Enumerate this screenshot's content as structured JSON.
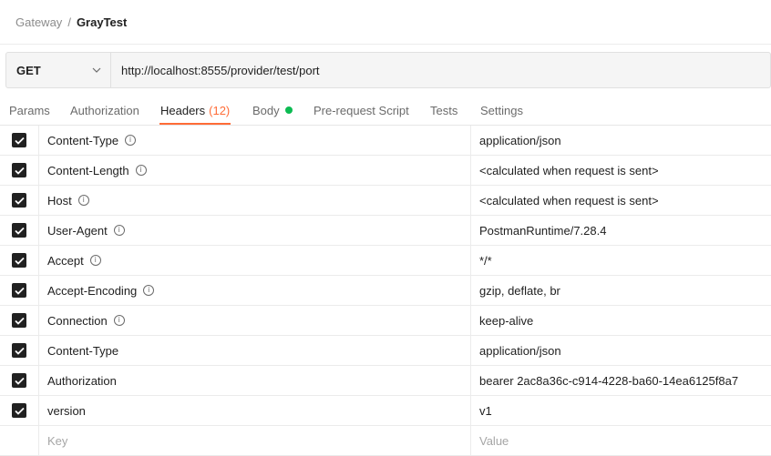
{
  "breadcrumb": {
    "parent": "Gateway",
    "separator": "/",
    "current": "GrayTest"
  },
  "request": {
    "method": "GET",
    "url": "http://localhost:8555/provider/test/port"
  },
  "tabs": [
    {
      "label": "Params",
      "count": "",
      "dot": false,
      "active": false
    },
    {
      "label": "Authorization",
      "count": "",
      "dot": false,
      "active": false
    },
    {
      "label": "Headers",
      "count": "(12)",
      "dot": false,
      "active": true
    },
    {
      "label": "Body",
      "count": "",
      "dot": true,
      "active": false
    },
    {
      "label": "Pre-request Script",
      "count": "",
      "dot": false,
      "active": false
    },
    {
      "label": "Tests",
      "count": "",
      "dot": false,
      "active": false
    },
    {
      "label": "Settings",
      "count": "",
      "dot": false,
      "active": false
    }
  ],
  "headers": [
    {
      "key": "Content-Type",
      "value": "application/json",
      "checked": true,
      "info": true
    },
    {
      "key": "Content-Length",
      "value": "<calculated when request is sent>",
      "checked": true,
      "info": true
    },
    {
      "key": "Host",
      "value": "<calculated when request is sent>",
      "checked": true,
      "info": true
    },
    {
      "key": "User-Agent",
      "value": "PostmanRuntime/7.28.4",
      "checked": true,
      "info": true
    },
    {
      "key": "Accept",
      "value": "*/*",
      "checked": true,
      "info": true
    },
    {
      "key": "Accept-Encoding",
      "value": "gzip, deflate, br",
      "checked": true,
      "info": true
    },
    {
      "key": "Connection",
      "value": "keep-alive",
      "checked": true,
      "info": true
    },
    {
      "key": "Content-Type",
      "value": "application/json",
      "checked": true,
      "info": false
    },
    {
      "key": "Authorization",
      "value": "bearer 2ac8a36c-c914-4228-ba60-14ea6125f8a7",
      "checked": true,
      "info": false
    },
    {
      "key": "version",
      "value": "v1",
      "checked": true,
      "info": false
    }
  ],
  "new_row": {
    "key_placeholder": "Key",
    "value_placeholder": "Value"
  },
  "colors": {
    "accent": "#ff6c37",
    "body_dot": "#0cbb52",
    "checkbox": "#212121"
  }
}
